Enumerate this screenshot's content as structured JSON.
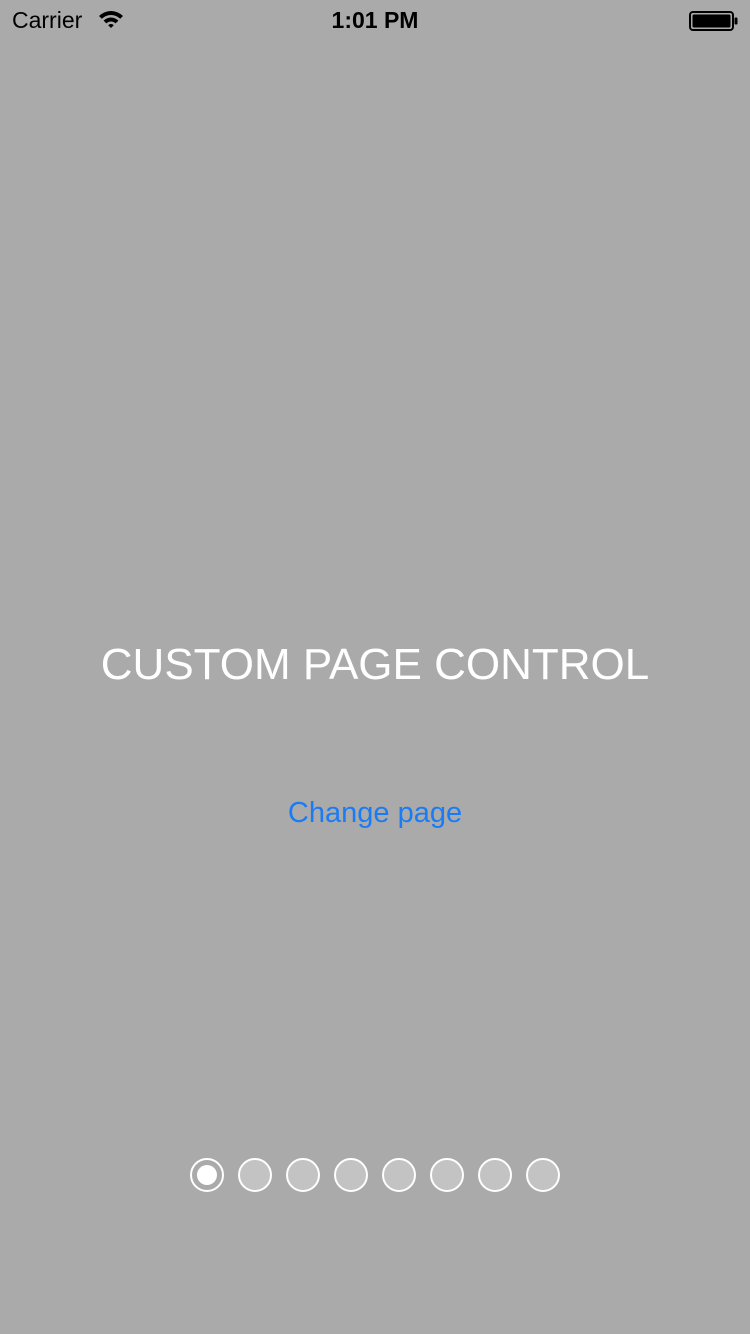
{
  "status_bar": {
    "carrier": "Carrier",
    "time": "1:01 PM",
    "wifi_icon": "wifi-icon",
    "battery_icon": "battery-full-icon"
  },
  "screen": {
    "background_color": "#aaaaaa",
    "title": "CUSTOM PAGE CONTROL",
    "button_label": "Change page",
    "button_color": "#1a7cf5"
  },
  "page_control": {
    "page_count": 8,
    "current_page": 1
  }
}
